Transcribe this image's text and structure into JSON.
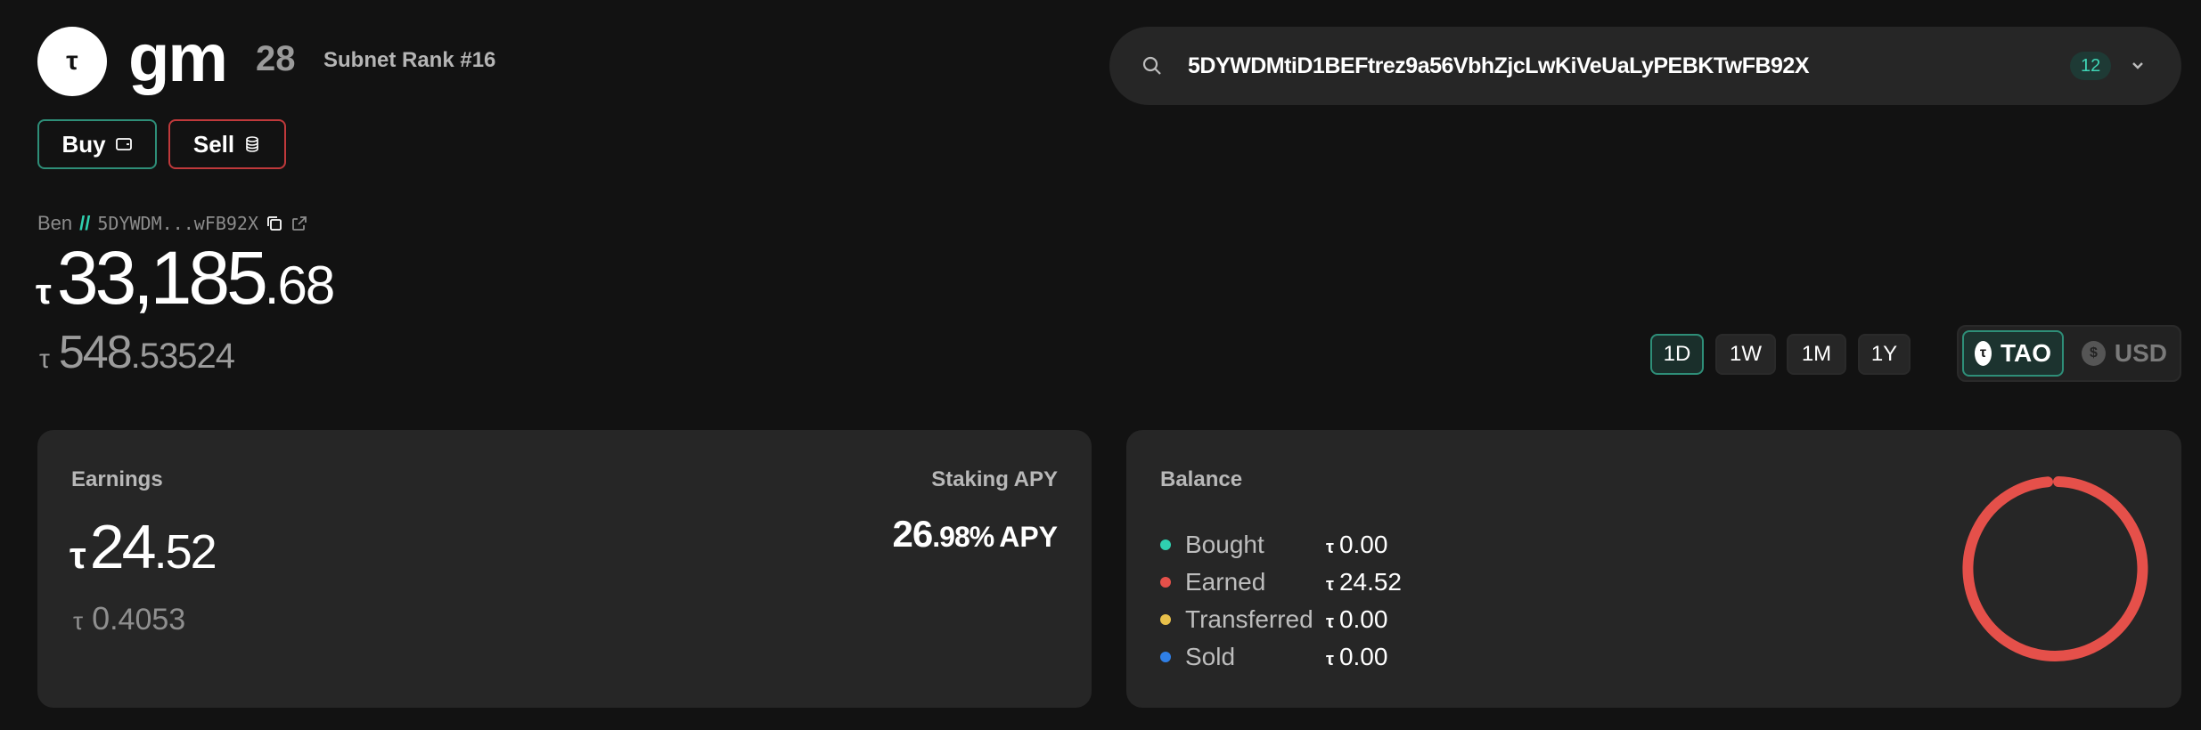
{
  "header": {
    "logo_symbol": "τ",
    "subnet_name": "gm",
    "subnet_number": "28",
    "subnet_rank": "Subnet Rank #16"
  },
  "actions": {
    "buy_label": "Buy",
    "sell_label": "Sell"
  },
  "wallet": {
    "name": "Ben",
    "separator": "//",
    "short_address": "5DYWDM...wFB92X",
    "balance_symbol": "τ",
    "balance_int": "33,185",
    "balance_dec": ".68",
    "sub_symbol": "τ",
    "sub_int": "548",
    "sub_dec": ".53524"
  },
  "search": {
    "value": "5DYWDMtiD1BEFtrez9a56VbhZjcLwKiVeUaLyPEBKTwFB92X",
    "count": "12"
  },
  "periods": [
    {
      "label": "1D",
      "active": true
    },
    {
      "label": "1W",
      "active": false
    },
    {
      "label": "1M",
      "active": false
    },
    {
      "label": "1Y",
      "active": false
    }
  ],
  "currency": {
    "tao_label": "TAO",
    "usd_label": "USD",
    "tao_icon": "τ",
    "usd_icon": "$",
    "selected": "TAO"
  },
  "earnings": {
    "title": "Earnings",
    "symbol": "τ",
    "amount_int": "24",
    "amount_dec": ".52",
    "sub_symbol": "τ",
    "sub_int": "0",
    "sub_dec": ".4053",
    "apy_title": "Staking APY",
    "apy_int": "26",
    "apy_dec": ".98%",
    "apy_unit": "APY"
  },
  "balance": {
    "title": "Balance",
    "symbol": "τ",
    "items": [
      {
        "label": "Bought",
        "value": "0.00",
        "color": "#2fd0b0"
      },
      {
        "label": "Earned",
        "value": "24.52",
        "color": "#e5504a"
      },
      {
        "label": "Transferred",
        "value": "0.00",
        "color": "#e8c04a"
      },
      {
        "label": "Sold",
        "value": "0.00",
        "color": "#2f7fe6"
      }
    ],
    "chart_ring_color": "#e5504a"
  }
}
